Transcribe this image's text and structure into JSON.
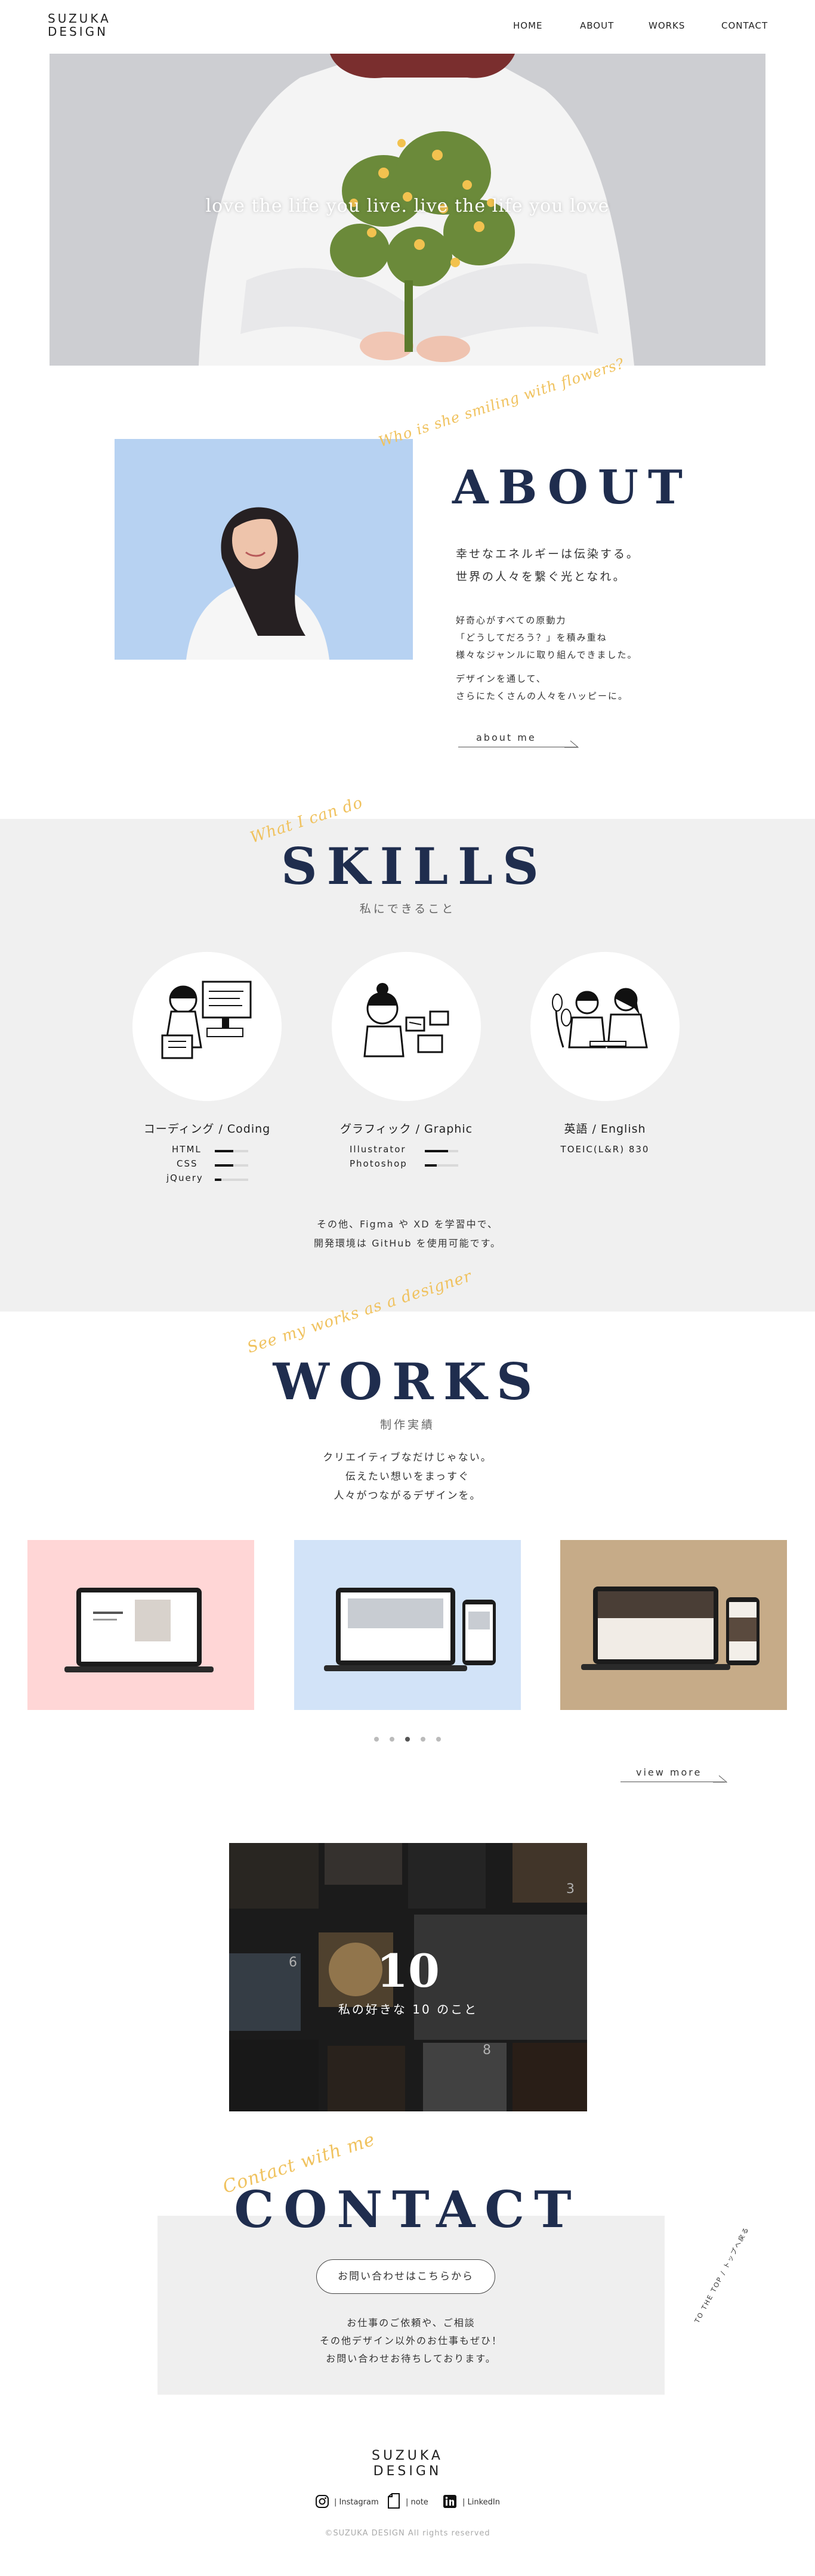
{
  "header": {
    "logo_line1": "SUZUKA",
    "logo_line2": "DESIGN",
    "nav": [
      "HOME",
      "ABOUT",
      "WORKS",
      "CONTACT"
    ]
  },
  "hero": {
    "tagline": "love the life you live. live the life you love"
  },
  "about": {
    "script": "Who is she smiling with flowers?",
    "heading": "ABOUT",
    "lead": [
      "幸せなエネルギーは伝染する。",
      "世界の人々を繋ぐ光となれ。"
    ],
    "body1": [
      "好奇心がすべての原動力",
      "「どうしてだろう？」を積み重ね",
      "様々なジャンルに取り組んできました。"
    ],
    "body2": [
      "デザインを通して、",
      "さらにたくさんの人々をハッピーに。"
    ],
    "link": "about me"
  },
  "skills": {
    "script": "What I can do",
    "heading": "SKILLS",
    "subheading": "私にできること",
    "items": [
      {
        "title": "コーディング / Coding",
        "rows": [
          {
            "label": "HTML",
            "level": 0.55
          },
          {
            "label": "CSS",
            "level": 0.55
          },
          {
            "label": "jQuery",
            "level": 0.2
          }
        ]
      },
      {
        "title": "グラフィック / Graphic",
        "rows": [
          {
            "label": "Illustrator",
            "level": 0.7
          },
          {
            "label": "Photoshop",
            "level": 0.35
          }
        ]
      },
      {
        "title": "英語 / English",
        "note": "TOEIC(L&R) 830"
      }
    ],
    "footnote": [
      "その他、Figma や XD を学習中で、",
      "開発環境は GitHub を使用可能です。"
    ]
  },
  "works": {
    "script": "See my works as a designer",
    "heading": "WORKS",
    "subheading": "制作実績",
    "lead": [
      "クリエイティブなだけじゃない。",
      "伝えたい想いをまっすぐ",
      "人々がつながるデザインを。"
    ],
    "card_colors": [
      "#ffd6d6",
      "#d2e3f8",
      "#c6ab88"
    ],
    "link": "view more"
  },
  "ten": {
    "number": "10",
    "caption": "私の好きな 10 のこと",
    "tile_numbers": [
      "3",
      "6",
      "8"
    ]
  },
  "contact": {
    "script": "Contact with me",
    "heading": "CONTACT",
    "button": "お問い合わせはこちらから",
    "text": [
      "お仕事のご依頼や、ご相談",
      "その他デザイン以外のお仕事もぜひ！",
      "お問い合わせお待ちしております。"
    ],
    "to_top": "TO THE TOP / トップへ戻る"
  },
  "footer": {
    "logo_line1": "SUZUKA",
    "logo_line2": "DESIGN",
    "links": [
      "Instagram",
      "note",
      "LinkedIn"
    ],
    "copyright": "©SUZUKA DESIGN All rights reserved"
  },
  "colors": {
    "navy": "#1f2d4e",
    "accent_script": "#f0c25e",
    "section_gray": "#f0f0f0"
  }
}
